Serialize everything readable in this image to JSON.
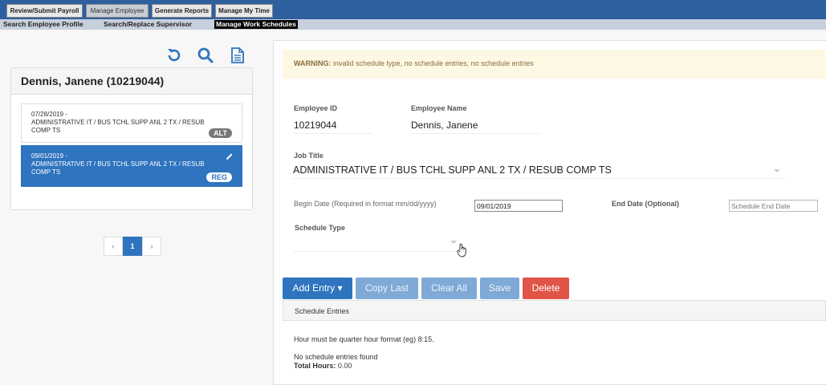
{
  "nav": {
    "tabs": [
      "Review/Submit Payroll",
      "Manage Employee",
      "Generate Reports",
      "Manage My Time"
    ],
    "active_tab": "Manage Employee",
    "subnav": [
      "Search Employee Profile",
      "Search/Replace Supervisor",
      "Manage Work Schedules"
    ],
    "active_subnav": "Manage Work Schedules"
  },
  "toolbar_icons": [
    "refresh-icon",
    "search-icon",
    "document-icon"
  ],
  "employee_card": {
    "title": "Dennis, Janene (10219044)",
    "schedules": [
      {
        "date": "07/28/2019 -",
        "title": "ADMINISTRATIVE IT / BUS TCHL SUPP ANL 2 TX / RESUB COMP TS",
        "badge": "ALT",
        "selected": false
      },
      {
        "date": "09/01/2019 -",
        "title": "ADMINISTRATIVE IT / BUS TCHL SUPP ANL 2 TX / RESUB COMP TS",
        "badge": "REG",
        "selected": true
      }
    ]
  },
  "pager": {
    "prev": "‹",
    "current": "1",
    "next": "›"
  },
  "warning": {
    "label": "WARNING:",
    "text": "invalid schedule type, no schedule entries, no schedule entries"
  },
  "form": {
    "employee_id_label": "Employee ID",
    "employee_id": "10219044",
    "employee_name_label": "Employee Name",
    "employee_name": "Dennis, Janene",
    "job_title_label": "Job Title",
    "job_title": "ADMINISTRATIVE IT / BUS TCHL SUPP ANL 2 TX / RESUB COMP TS",
    "begin_date_label": "Begin Date (Required in format mm/dd/yyyy)",
    "begin_date": "09/01/2019",
    "end_date_label": "End Date (Optional)",
    "end_date_placeholder": "Schedule End Date",
    "schedule_type_label": "Schedule Type",
    "schedule_type": ""
  },
  "buttons": {
    "add_entry": "Add Entry ▾",
    "copy_last": "Copy Last",
    "clear_all": "Clear All",
    "save": "Save",
    "delete": "Delete"
  },
  "entries": {
    "header": "Schedule Entries",
    "hint": "Hour must be quarter hour format (eg) 8:15.",
    "empty": "No schedule entries found",
    "total_label": "Total Hours:",
    "total_value": "0.00"
  },
  "colors": {
    "primary": "#2f74bf",
    "danger": "#e05548",
    "nav": "#2e5f9e",
    "warning_bg": "#fcf8e3"
  }
}
